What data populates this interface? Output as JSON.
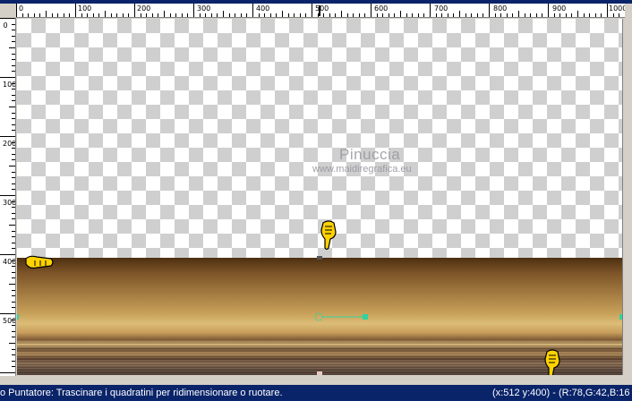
{
  "ruler_top": {
    "labels": [
      "0",
      "100",
      "200",
      "300",
      "400",
      "500",
      "600",
      "700",
      "800",
      "900",
      "1000"
    ]
  },
  "ruler_left": {
    "labels": [
      "0",
      "100",
      "200",
      "300",
      "400",
      "500"
    ]
  },
  "canvas": {
    "watermark_title": "Pinuccia",
    "watermark_sub": "www.maidiregrafica.eu"
  },
  "status": {
    "message": "o Puntatore: Trascinare i quadratini per ridimensionare o ruotare.",
    "coords": "(x:512 y:400) - (R:78,G:42,B:16"
  },
  "icons": [
    "pointing-hand-icon",
    "rotation-handle-icon"
  ]
}
